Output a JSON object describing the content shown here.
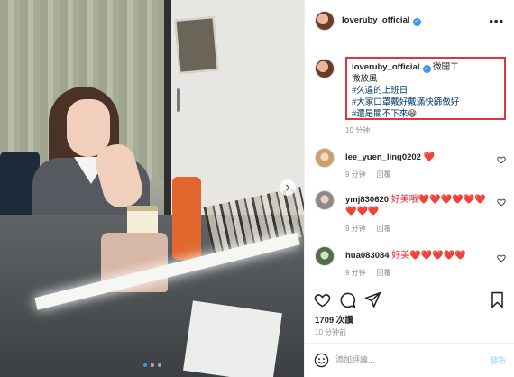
{
  "post": {
    "username": "loveruby_official",
    "more_icon": "•••",
    "caption": {
      "lines": [
        "微開工",
        "微放風",
        "#久違的上班日",
        "#大家口罩戴好戴滿快篩做好",
        "#還是關不下來"
      ],
      "emoji": "😁",
      "time": "10 分钟"
    },
    "comments": [
      {
        "user": "lee_yuen_ling0202",
        "text": "❤️",
        "time": "9 分钟",
        "reply": "回覆"
      },
      {
        "user": "ymj830620",
        "text": "好美哦❤️❤️❤️❤️❤️❤️❤️❤️❤️",
        "time": "9 分钟",
        "reply": "回覆"
      },
      {
        "user": "hua083084",
        "text": "好美❤️❤️❤️❤️❤️",
        "time": "9 分钟",
        "reply": "回覆"
      }
    ],
    "likes": "1709 次讚",
    "posted": "10 分钟前",
    "comment_placeholder": "添加評論...",
    "post_button": "發布"
  },
  "carousel": {
    "total": 3,
    "active": 1
  },
  "icons": [
    "verified-badge-icon",
    "more-options-icon",
    "heart-icon",
    "comment-icon",
    "share-icon",
    "bookmark-icon",
    "emoji-icon",
    "carousel-next-icon"
  ],
  "colors": {
    "accent": "#3897f0",
    "highlight_box": "#e0353a",
    "tag": "#00376b",
    "heart": "#ed2334"
  }
}
